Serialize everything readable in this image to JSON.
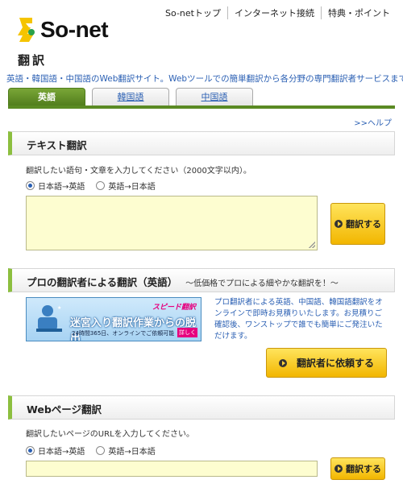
{
  "header": {
    "logo_text": "So-net",
    "nav": [
      "So-netトップ",
      "インターネット接続",
      "特典・ポイント"
    ],
    "page_title": "翻訳",
    "tagline": "英語・韓国語・中国語のWeb翻訳サイト。Webツールでの簡単翻訳から各分野の専門翻訳者サービスまで"
  },
  "tabs": [
    {
      "label": "英語",
      "active": true
    },
    {
      "label": "韓国語",
      "active": false
    },
    {
      "label": "中国語",
      "active": false
    }
  ],
  "help_link": ">>ヘルプ",
  "text_translation": {
    "title": "テキスト翻訳",
    "instruction": "翻訳したい語句・文章を入力してください（2000文字以内）。",
    "options": [
      "日本語→英語",
      "英語→日本語"
    ],
    "selected": 0,
    "input_value": "",
    "button": "翻訳する"
  },
  "pro_translation": {
    "title": "プロの翻訳者による翻訳（英語）",
    "subtitle": "〜低価格でプロによる細やかな翻訳を！〜",
    "banner": {
      "tag": "スピード翻訳",
      "main": "迷宮入り翻訳作業からの脱出",
      "sub": "24時間365日、オンラインでご依頼可能",
      "badge": "詳しく"
    },
    "description": "プロ翻訳者による英語、中国語、韓国語翻訳をオンラインで即時お見積りいたします。お見積りご確認後、ワンストップで誰でも簡単にご発注いただけます。",
    "button": "翻訳者に依頼する"
  },
  "web_translation": {
    "title": "Webページ翻訳",
    "instruction": "翻訳したいページのURLを入力してください。",
    "options": [
      "日本語→英語",
      "英語→日本語"
    ],
    "selected": 0,
    "input_value": "",
    "button": "翻訳する"
  },
  "colors": {
    "accent_green": "#5a8a23",
    "link_blue": "#2a5fb3",
    "button_yellow": "#f2b600",
    "input_bg": "#fdfdd0"
  }
}
